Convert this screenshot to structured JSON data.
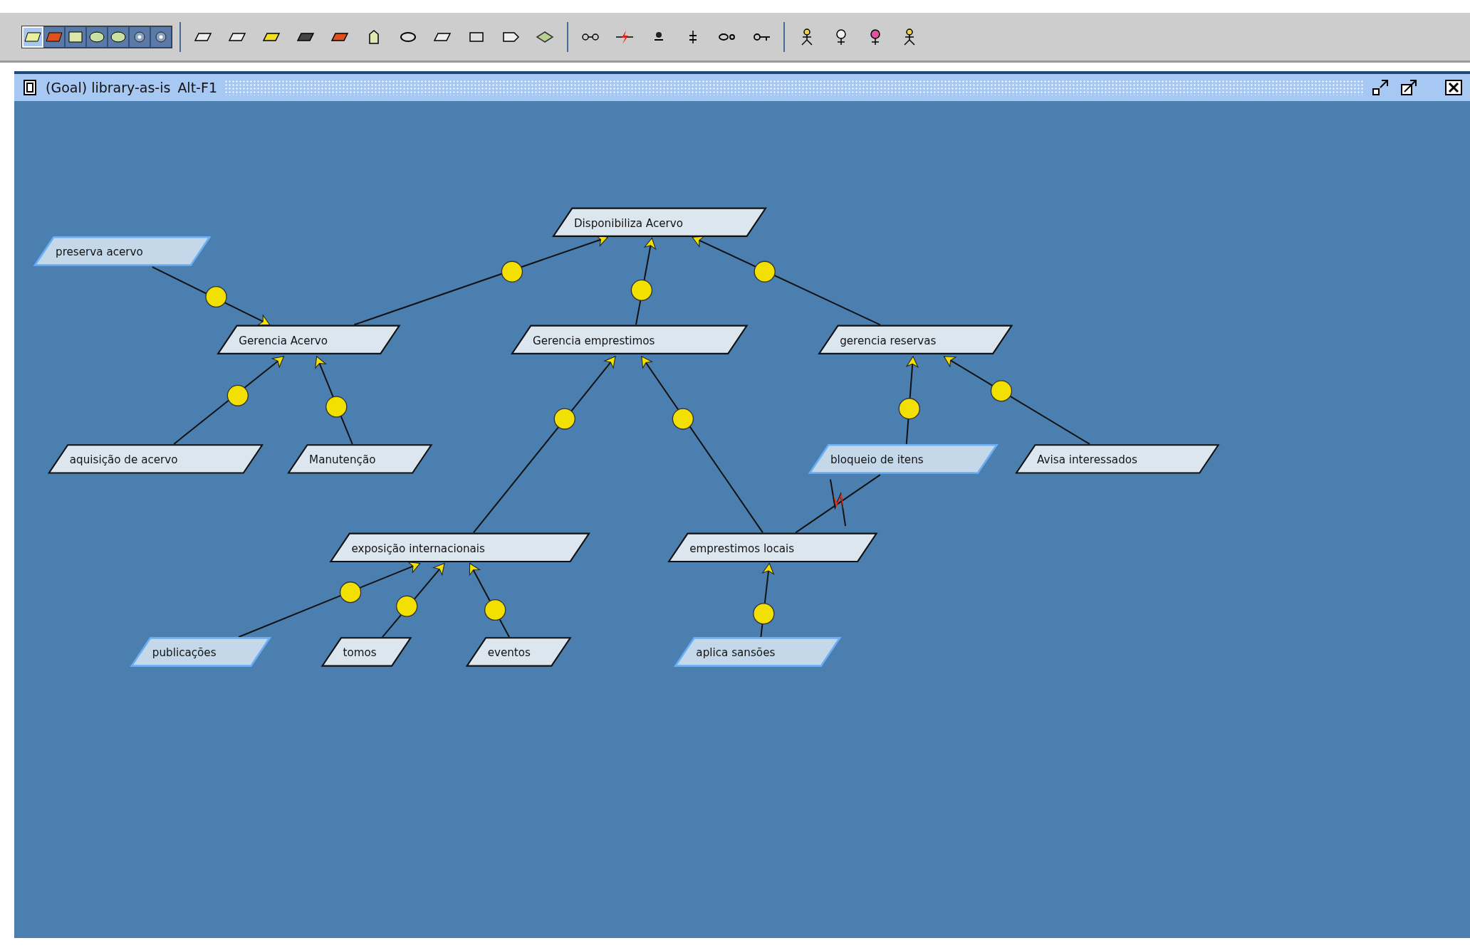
{
  "toolbar": {
    "palette": [
      {
        "selected": true
      },
      {
        "selected": false
      },
      {
        "selected": false
      },
      {
        "selected": false
      },
      {
        "selected": false
      },
      {
        "selected": false
      },
      {
        "selected": false
      }
    ]
  },
  "window": {
    "title": "(Goal) library-as-is",
    "shortcut": "Alt-F1"
  },
  "diagram": {
    "nodes": [
      {
        "label": "Disponibiliza Acervo",
        "highlighted": false
      },
      {
        "label": "preserva acervo",
        "highlighted": true
      },
      {
        "label": "Gerencia Acervo",
        "highlighted": false
      },
      {
        "label": "Gerencia emprestimos",
        "highlighted": false
      },
      {
        "label": "gerencia reservas",
        "highlighted": false
      },
      {
        "label": "aquisição de acervo",
        "highlighted": false
      },
      {
        "label": "Manutenção",
        "highlighted": false
      },
      {
        "label": "bloqueio de itens",
        "highlighted": true
      },
      {
        "label": "Avisa interessados",
        "highlighted": false
      },
      {
        "label": "exposição internacionais",
        "highlighted": false
      },
      {
        "label": "emprestimos locais",
        "highlighted": false
      },
      {
        "label": "publicações",
        "highlighted": true
      },
      {
        "label": "tomos",
        "highlighted": false
      },
      {
        "label": "eventos",
        "highlighted": false
      },
      {
        "label": "aplica sansões",
        "highlighted": true
      }
    ],
    "links": [
      {
        "kind": "means_end"
      },
      {
        "kind": "means_end"
      },
      {
        "kind": "means_end"
      },
      {
        "kind": "means_end"
      },
      {
        "kind": "means_end"
      },
      {
        "kind": "means_end"
      },
      {
        "kind": "means_end"
      },
      {
        "kind": "means_end"
      },
      {
        "kind": "means_end"
      },
      {
        "kind": "means_end"
      },
      {
        "kind": "means_end"
      },
      {
        "kind": "means_end"
      },
      {
        "kind": "means_end"
      },
      {
        "kind": "means_end"
      },
      {
        "kind": "conflict"
      }
    ]
  }
}
